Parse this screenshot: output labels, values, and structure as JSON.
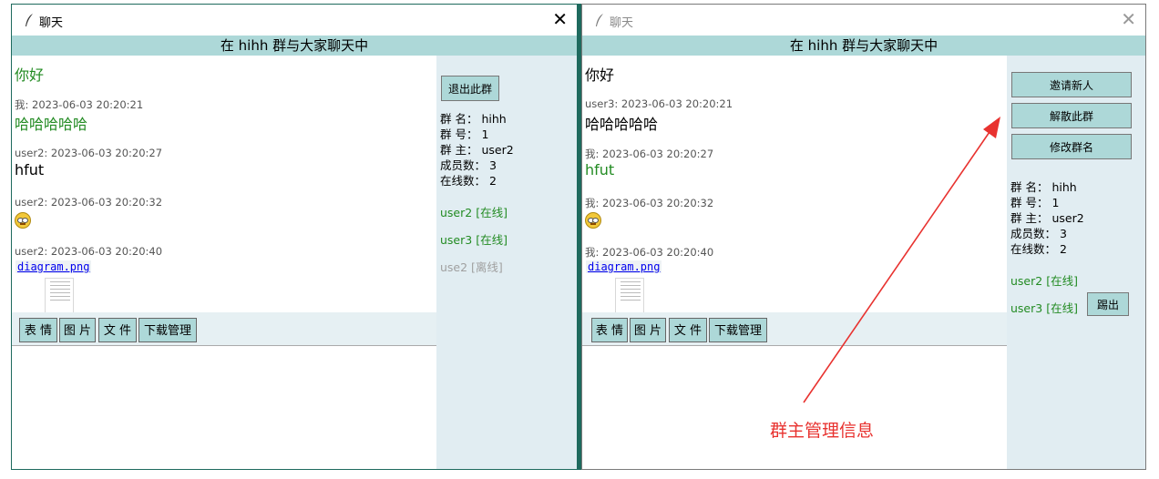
{
  "left": {
    "title": "聊天",
    "close": "✕",
    "header": "在 hihh 群与大家聊天中",
    "messages": [
      {
        "text": "你好"
      },
      {
        "meta": "我: 2023-06-03 20:20:21",
        "text": "哈哈哈哈哈"
      },
      {
        "meta": "user2: 2023-06-03 20:20:27",
        "text": "hfut"
      },
      {
        "meta": "user2: 2023-06-03 20:20:32"
      },
      {
        "meta": "user2: 2023-06-03 20:20:40",
        "file": "diagram.png"
      }
    ],
    "toolbar": [
      "表 情",
      "图 片",
      "文 件",
      "下载管理"
    ],
    "quit_button": "退出此群",
    "info": [
      "群 名： hihh",
      "群 号： 1",
      "群 主： user2",
      "成员数： 3",
      "在线数： 2"
    ],
    "members": [
      "user2 [在线]",
      "user3 [在线]",
      "use2 [离线]"
    ]
  },
  "right": {
    "title": "聊天",
    "close": "✕",
    "header": "在 hihh 群与大家聊天中",
    "messages": [
      {
        "text": "你好"
      },
      {
        "meta": "user3: 2023-06-03 20:20:21",
        "text": "哈哈哈哈哈"
      },
      {
        "meta": "我: 2023-06-03 20:20:27",
        "text": "hfut"
      },
      {
        "meta": "我: 2023-06-03 20:20:32"
      },
      {
        "meta": "我: 2023-06-03 20:20:40",
        "file": "diagram.png"
      }
    ],
    "toolbar": [
      "表 情",
      "图 片",
      "文 件",
      "下载管理"
    ],
    "buttons": [
      "邀请新人",
      "解散此群",
      "修改群名"
    ],
    "info": [
      "群 名： hihh",
      "群 号： 1",
      "群 主： user2",
      "成员数： 3",
      "在线数： 2"
    ],
    "members": [
      "user2 [在线]",
      "user3 [在线]"
    ],
    "kick_button": "踢出"
  },
  "annotation": "群主管理信息",
  "colors": {
    "header_bg": "#add8d8",
    "sidebar_bg": "#e1edf2",
    "online_green": "#228b22",
    "annotation_red": "#e8322f"
  }
}
